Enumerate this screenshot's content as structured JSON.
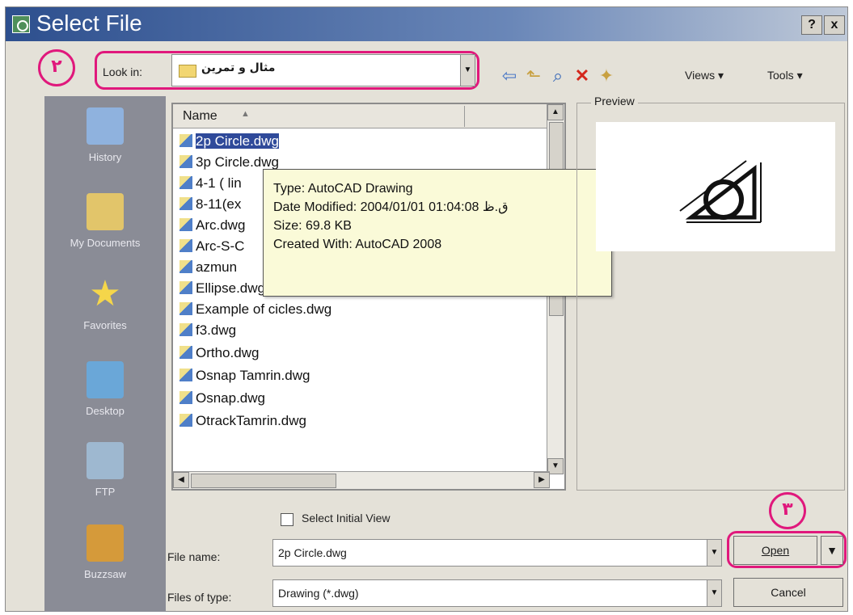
{
  "window": {
    "title": "Select File",
    "help_glyph": "?",
    "close_glyph": "x"
  },
  "annotations": {
    "step2": "۲",
    "step3": "۳"
  },
  "toolbar": {
    "look_in_label": "Look in:",
    "look_in_value": "مثال و تمرین",
    "views_label": "Views",
    "tools_label": "Tools",
    "icons": [
      "back-icon",
      "up-folder-icon",
      "search-web-icon",
      "delete-icon",
      "new-folder-icon"
    ]
  },
  "places": [
    {
      "label": "History",
      "icon": "history-icon"
    },
    {
      "label": "My Documents",
      "icon": "my-documents-icon"
    },
    {
      "label": "Favorites",
      "icon": "favorites-icon"
    },
    {
      "label": "Desktop",
      "icon": "desktop-icon"
    },
    {
      "label": "FTP",
      "icon": "ftp-icon"
    },
    {
      "label": "Buzzsaw",
      "icon": "buzzsaw-icon"
    }
  ],
  "file_list": {
    "column_name": "Name",
    "files": [
      "2p Circle.dwg",
      "3p Circle.dwg",
      "4-1 ( lin",
      "8-11(ex",
      "Arc.dwg",
      "Arc-S-C",
      "azmun",
      "Ellipse.dwg",
      "Example of cicles.dwg",
      "f3.dwg",
      "Ortho.dwg",
      "Osnap Tamrin.dwg",
      "Osnap.dwg",
      "OtrackTamrin.dwg"
    ],
    "selected_index": 0
  },
  "tooltip": {
    "type": "Type: AutoCAD Drawing",
    "date": "Date Modified: 2004/01/01 01:04:08 ق.ظ",
    "size": "Size: 69.8 KB",
    "created": "Created With: AutoCAD 2008"
  },
  "preview": {
    "label": "Preview"
  },
  "bottom": {
    "select_initial_view": "Select Initial View",
    "file_name_label": "File name:",
    "file_name_value": "2p Circle.dwg",
    "files_of_type_label": "Files of type:",
    "files_of_type_value": "Drawing (*.dwg)",
    "open_label": "Open",
    "cancel_label": "Cancel"
  }
}
